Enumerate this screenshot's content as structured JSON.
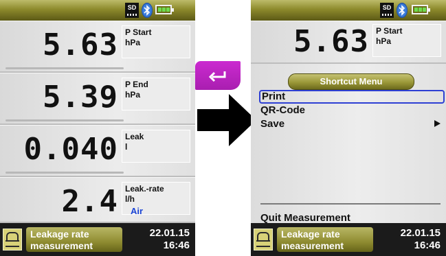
{
  "status_bar": {
    "sd_label": "SD"
  },
  "measurements": [
    {
      "value": "5.63",
      "label": "P Start",
      "unit": "hPa"
    },
    {
      "value": "5.39",
      "label": "P End",
      "unit": "hPa"
    },
    {
      "value": "0.040",
      "label": "Leak",
      "unit": "l"
    },
    {
      "value": "2.4",
      "label": "Leak.-rate",
      "unit": "l/h"
    }
  ],
  "gas": "Air",
  "app": {
    "line1": "Leakage rate",
    "line2": "measurement"
  },
  "date": "22.01.15",
  "time": "16:46",
  "menu": {
    "title": "Shortcut Menu",
    "items": [
      "Print",
      "QR-Code",
      "Save"
    ],
    "selected": "Print",
    "quit": "Quit Measurement"
  },
  "colors": {
    "bar_olive": "#8d8a2c",
    "back_button": "#c026c8",
    "selection": "#2d3fd4",
    "gas_text": "#1a44d6"
  },
  "icons": [
    "sd-card-icon",
    "bluetooth-icon",
    "battery-icon",
    "leak-test-icon",
    "back-arrow-icon",
    "right-arrow-icon",
    "submenu-arrow-icon"
  ]
}
